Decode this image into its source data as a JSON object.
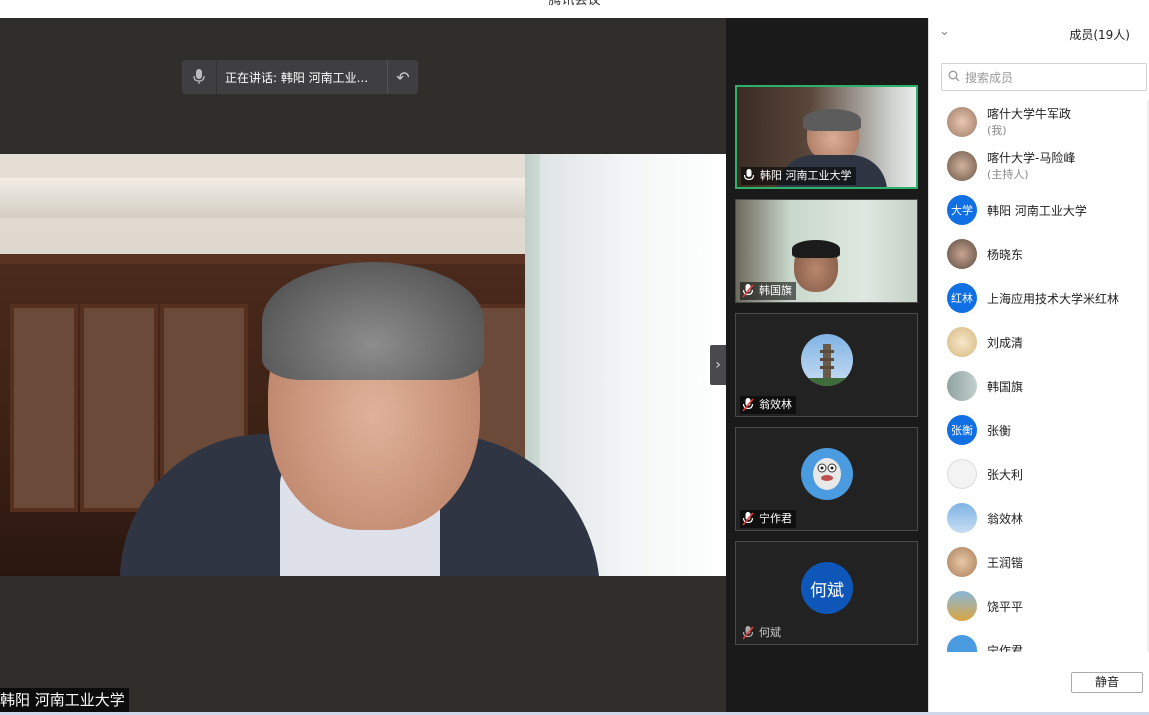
{
  "window": {
    "title": "腾讯会议"
  },
  "speaking": {
    "text": "正在讲话: 韩阳 河南工业..."
  },
  "main_video": {
    "name": "韩阳 河南工业大学"
  },
  "thumbnails": [
    {
      "name": "韩阳 河南工业大学",
      "active": true,
      "mic": "on"
    },
    {
      "name": "韩国旗",
      "active": false,
      "mic": "muted"
    },
    {
      "name": "翁效林",
      "active": false,
      "mic": "muted"
    },
    {
      "name": "宁作君",
      "active": false,
      "mic": "muted"
    },
    {
      "name": "何斌",
      "active": false,
      "mic": "muted",
      "avatar_text": "何斌"
    }
  ],
  "members": {
    "title": "成员(19人)",
    "search_placeholder": "搜索成员",
    "list": [
      {
        "name": "喀什大学牛军政",
        "sub": "(我)"
      },
      {
        "name": "喀什大学-马险峰",
        "sub": "(主持人)"
      },
      {
        "name": "韩阳 河南工业大学",
        "avatar_text": "大学"
      },
      {
        "name": "杨晓东"
      },
      {
        "name": "上海应用技术大学米红林",
        "avatar_text": "红林"
      },
      {
        "name": "刘成清"
      },
      {
        "name": "韩国旗"
      },
      {
        "name": "张衡",
        "avatar_text": "张衡"
      },
      {
        "name": "张大利"
      },
      {
        "name": "翁效林"
      },
      {
        "name": "王润锴"
      },
      {
        "name": "饶平平"
      },
      {
        "name": "宁作君"
      }
    ],
    "mute_all_label": "静音"
  },
  "colors": {
    "active_border": "#2eb06a",
    "avatar_blue": "#0f6fe3"
  }
}
